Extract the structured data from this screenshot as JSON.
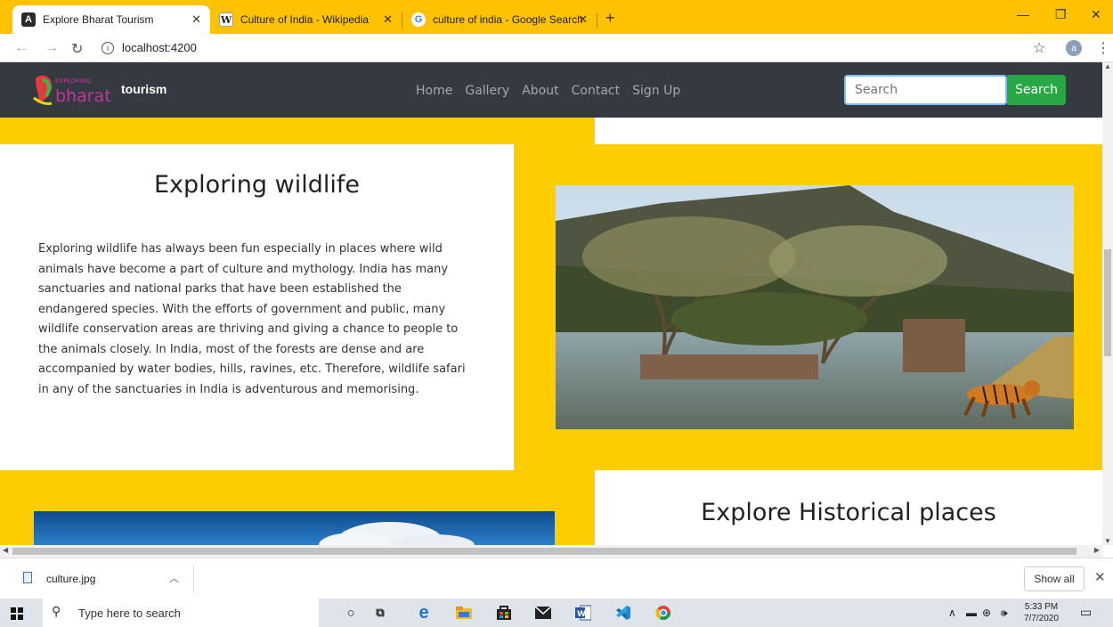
{
  "browser": {
    "tabs": [
      {
        "title": "Explore Bharat Tourism",
        "active": true
      },
      {
        "title": "Culture of India - Wikipedia",
        "active": false
      },
      {
        "title": "culture of india - Google Search",
        "active": false
      }
    ],
    "url": "localhost:4200",
    "profile_initial": "a"
  },
  "site": {
    "brand": "tourism",
    "logo_text_top": "EXPLORING",
    "logo_text_main": "bharat",
    "nav": [
      "Home",
      "Gallery",
      "About",
      "Contact",
      "Sign Up"
    ],
    "search_placeholder": "Search",
    "search_button": "Search"
  },
  "sections": {
    "wildlife": {
      "title": "Exploring wildlife",
      "text": "Exploring wildlife has always been fun especially in places where wild animals have become a part of culture and mythology. India has many sanctuaries and national parks that have been established the endangered species. With the efforts of government and public, many wildlife conservation areas are thriving and giving a chance to people to the animals closely. In India, most of the forests are dense and are accompanied by water bodies, hills, ravines, etc. Therefore, wildlife safari in any of the sanctuaries in India is adventurous and memorising."
    },
    "historical": {
      "title": "Explore Historical places"
    }
  },
  "downloads": {
    "file": "culture.jpg",
    "show_all": "Show all"
  },
  "taskbar": {
    "search_placeholder": "Type here to search",
    "time": "5:33 PM",
    "date": "7/7/2020"
  },
  "colors": {
    "accent_yellow": "#fecd00",
    "navbar": "#343a40",
    "search_green": "#28a745"
  }
}
